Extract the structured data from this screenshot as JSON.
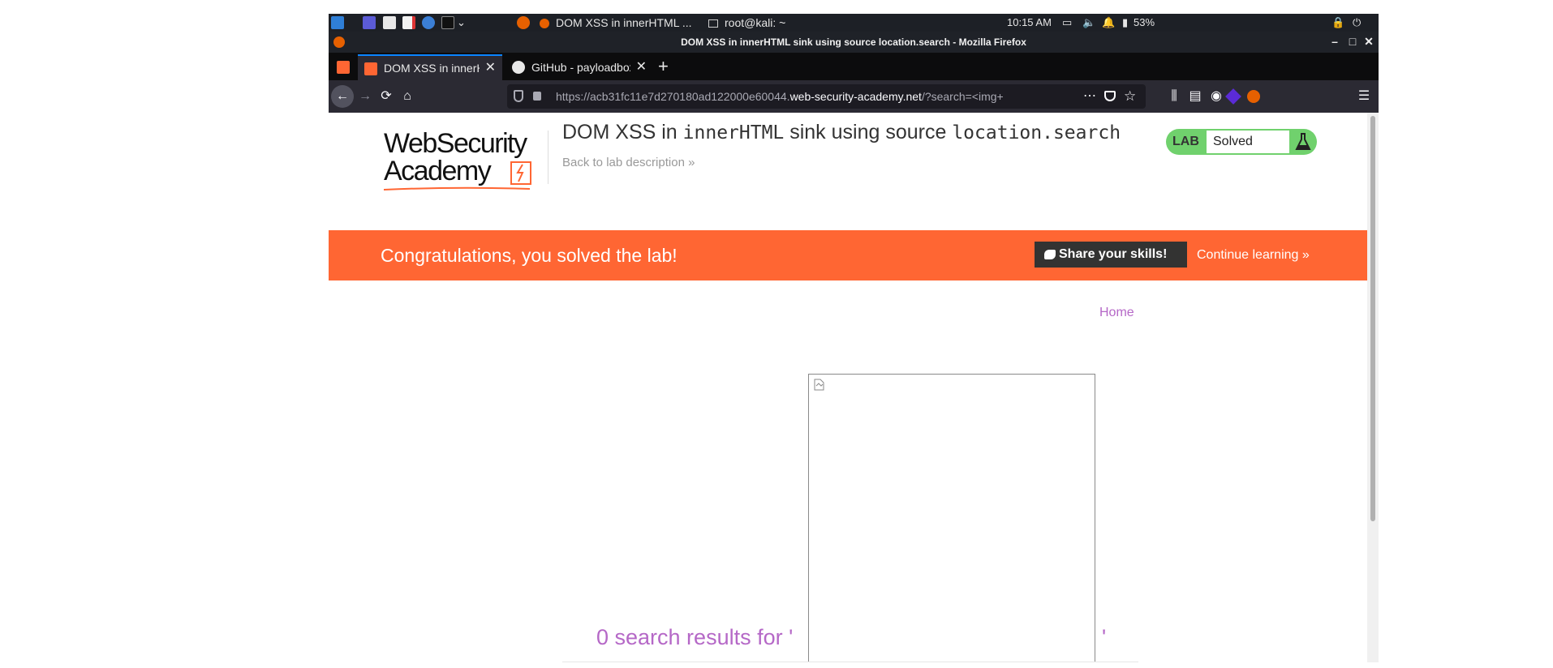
{
  "os_panel": {
    "tasks": [
      {
        "label": "DOM XSS in innerHTML ..."
      },
      {
        "label": "root@kali: ~"
      }
    ],
    "clock": "10:15 AM",
    "battery": "53%"
  },
  "window": {
    "title": "DOM XSS in innerHTML sink using source location.search - Mozilla Firefox"
  },
  "tabs": [
    {
      "label": "DOM XSS in innerHTML",
      "active": true
    },
    {
      "label": "GitHub - payloadbox/xss",
      "active": false
    }
  ],
  "navbar": {
    "url_prefix": "https://acb31fc11e7d270180ad122000e60044.",
    "url_domain": "web-security-academy.net",
    "url_suffix": "/?search=<img+"
  },
  "page": {
    "logo_line1": "WebSecurity",
    "logo_line2": "Academy",
    "title_parts": {
      "p1": "DOM XSS in ",
      "m1": "innerHTML",
      "p2": " sink using source ",
      "m2": "location.search"
    },
    "back_link": "Back to lab description »",
    "lab_badge": {
      "label": "LAB",
      "status": "Solved"
    },
    "banner": {
      "message": "Congratulations, you solved the lab!",
      "share_label": "Share your skills!",
      "continue_label": "Continue learning »"
    },
    "home_link": "Home",
    "results_text": "0 search results for '",
    "results_close": "'"
  },
  "colors": {
    "accent_orange": "#ff6633",
    "lab_green": "#70d16d",
    "link_purple": "#b568c7"
  }
}
